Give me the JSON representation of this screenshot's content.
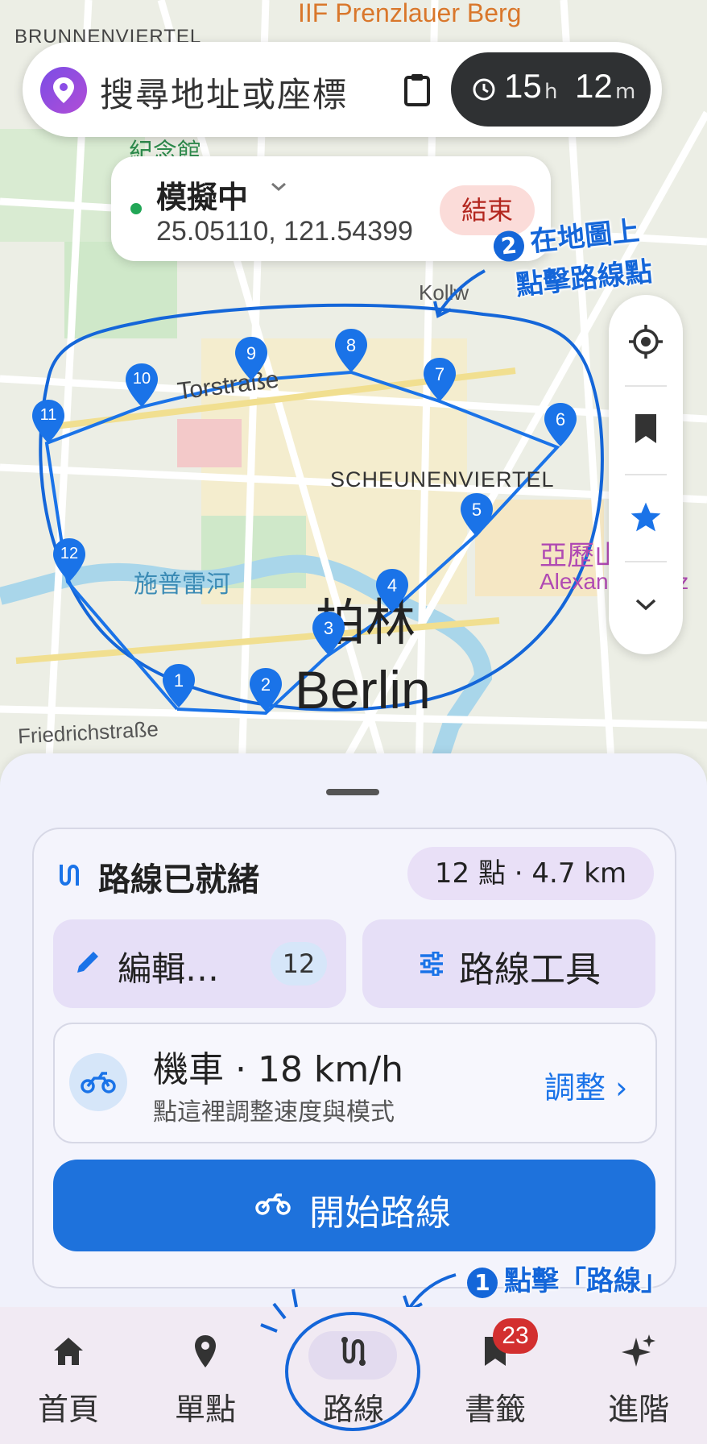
{
  "map": {
    "labels": {
      "top_district": "Prenzlauer Berg",
      "brunnen": "BRUNNENVIERTEL",
      "memorial": "紀念館",
      "torstrasse": "Torstraße",
      "scheunen": "SCHEUNENVIERTEL",
      "river": "施普雷河",
      "city_zh": "柏林",
      "city_en": "Berlin",
      "friedrich": "Friedrichstraße",
      "alex_zh": "亞歷山大",
      "alex_en": "Alexanderplatz",
      "kol": "Kollw"
    },
    "waypoints": [
      "1",
      "2",
      "3",
      "4",
      "5",
      "6",
      "7",
      "8",
      "9",
      "10",
      "11",
      "12"
    ],
    "route_color": "#1a73e8"
  },
  "search": {
    "placeholder": "搜尋地址或座標",
    "paste_icon": "clipboard-icon"
  },
  "timer": {
    "hours": "15",
    "hours_unit": "h",
    "minutes": "12",
    "minutes_unit": "m"
  },
  "status": {
    "title": "模擬中",
    "coords": "25.05110, 121.54399",
    "end_label": "結束"
  },
  "controls": {
    "icons": [
      "locate-icon",
      "bookmark-icon",
      "star-icon",
      "chevron-down-icon"
    ]
  },
  "annotations": {
    "step2_num": "2",
    "step2_line1": "在地圖上",
    "step2_line2": "點擊路線點",
    "step1_num": "1",
    "step1_text": "點擊「路線」"
  },
  "route_card": {
    "title": "路線已就緒",
    "points_pill": "12 點 · 4.7 km",
    "edit_label": "編輯…",
    "edit_count": "12",
    "tools_label": "路線工具",
    "vehicle_title": "機車 · 18 km/h",
    "vehicle_sub": "點這裡調整速度與模式",
    "adjust_label": "調整 ›",
    "start_label": "開始路線"
  },
  "nav": {
    "items": [
      {
        "label": "首頁",
        "icon": "home-icon"
      },
      {
        "label": "單點",
        "icon": "pin-icon"
      },
      {
        "label": "路線",
        "icon": "route-icon"
      },
      {
        "label": "書籤",
        "icon": "bookmark-icon",
        "badge": "23"
      },
      {
        "label": "進階",
        "icon": "sparkle-icon"
      }
    ]
  }
}
